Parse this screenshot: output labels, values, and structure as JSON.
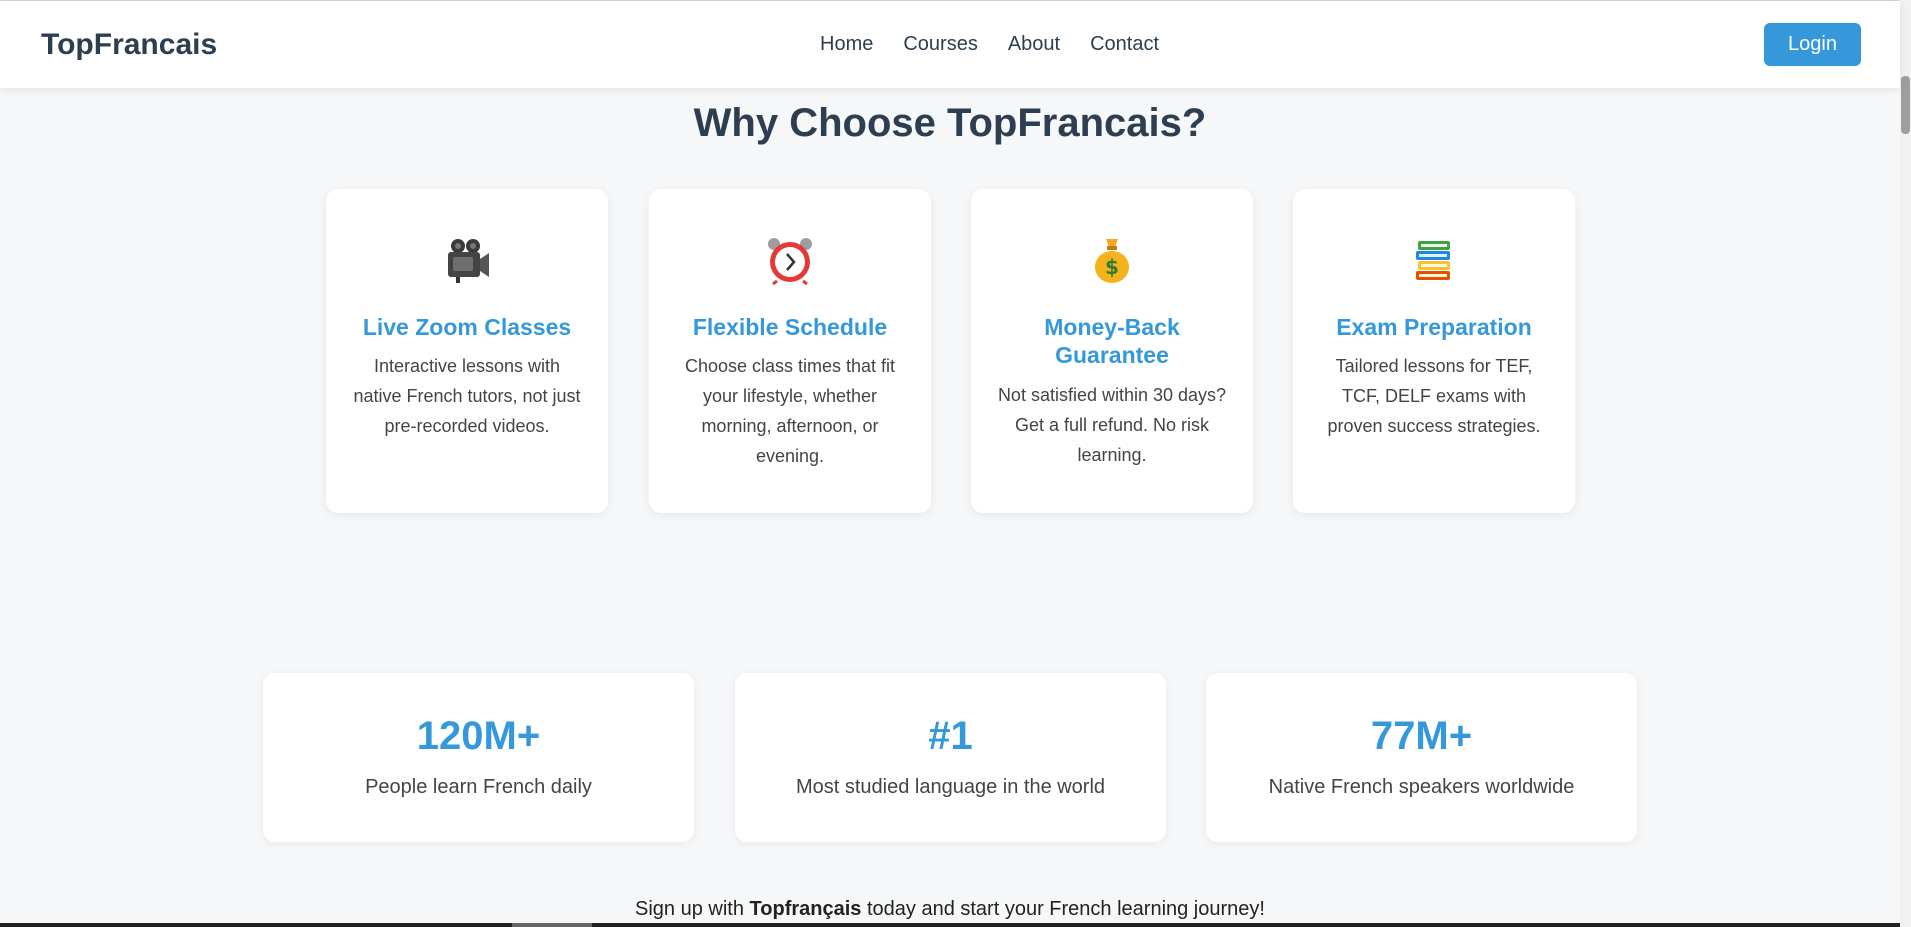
{
  "header": {
    "logo": "TopFrancais",
    "nav": [
      "Home",
      "Courses",
      "About",
      "Contact"
    ],
    "login_label": "Login"
  },
  "features_section": {
    "title": "Why Choose TopFrancais?",
    "cards": [
      {
        "icon": "movie-camera-icon",
        "title": "Live Zoom Classes",
        "text": "Interactive lessons with native French tutors, not just pre-recorded videos."
      },
      {
        "icon": "alarm-clock-icon",
        "title": "Flexible Schedule",
        "text": "Choose class times that fit your lifestyle, whether morning, afternoon, or evening."
      },
      {
        "icon": "money-bag-icon",
        "title": "Money-Back Guarantee",
        "text": "Not satisfied within 30 days? Get a full refund. No risk learning."
      },
      {
        "icon": "books-icon",
        "title": "Exam Preparation",
        "text": "Tailored lessons for TEF, TCF, DELF exams with proven success strategies."
      }
    ]
  },
  "stats": [
    {
      "value": "120M+",
      "label": "People learn French daily"
    },
    {
      "value": "#1",
      "label": "Most studied language in the world"
    },
    {
      "value": "77M+",
      "label": "Native French speakers worldwide"
    }
  ],
  "cta": {
    "prefix": "Sign up with ",
    "brand": "Topfrançais",
    "suffix": " today and start your French learning journey!"
  },
  "colors": {
    "accent": "#3498db",
    "heading": "#2c3e50",
    "background": "#f5f7f9"
  }
}
